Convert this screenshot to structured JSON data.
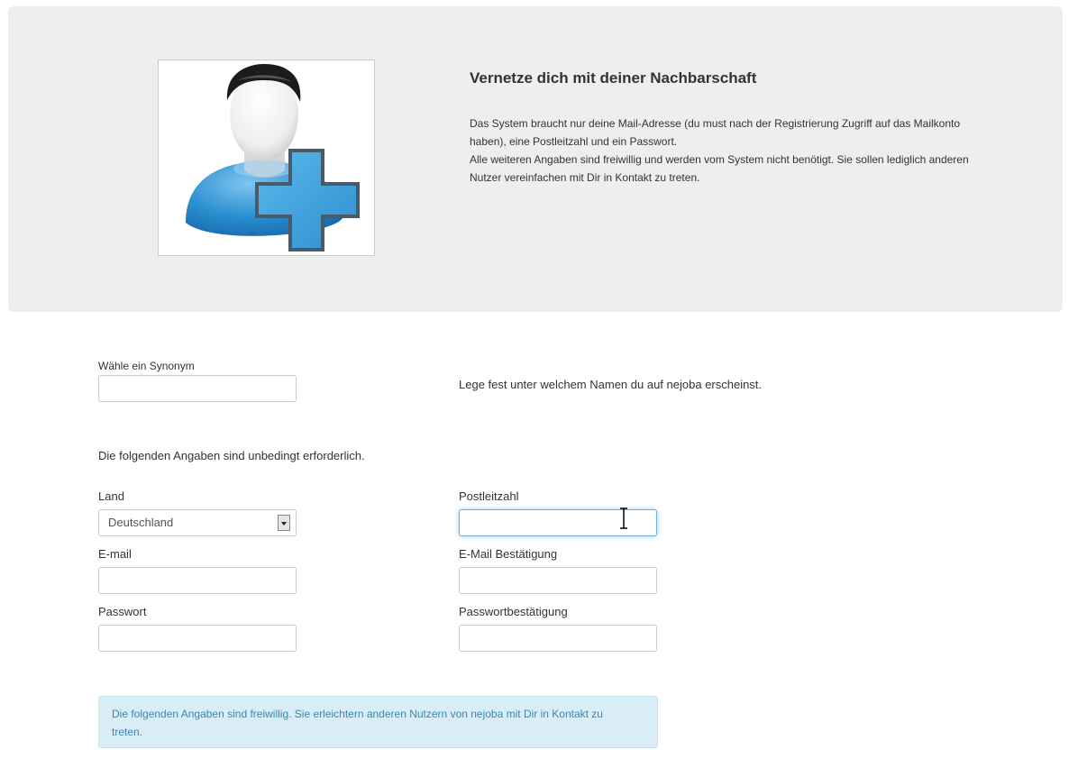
{
  "hero": {
    "title": "Vernetze dich mit deiner Nachbarschaft",
    "paragraph1": "Das System braucht nur deine Mail-Adresse (du must nach der Registrierung Zugriff auf das Mailkonto haben), eine Postleitzahl und ein Passwort.",
    "paragraph2": "Alle weiteren Angaben sind freiwillig und werden vom System nicht benötigt. Sie sollen lediglich anderen Nutzer vereinfachen mit Dir in Kontakt zu treten.",
    "image_icon": "user-add-icon"
  },
  "synonym": {
    "label": "Wähle ein Synonym",
    "value": "",
    "hint": "Lege fest unter welchem Namen du auf nejoba erscheinst."
  },
  "required_note": "Die folgenden Angaben sind unbedingt erforderlich.",
  "form": {
    "country_label": "Land",
    "country_value": "Deutschland",
    "zip_label": "Postleitzahl",
    "zip_value": "",
    "email_label": "E-mail",
    "email_value": "",
    "email_confirm_label": "E-Mail Bestätigung",
    "email_confirm_value": "",
    "password_label": "Passwort",
    "password_value": "",
    "password_confirm_label": "Passwortbestätigung",
    "password_confirm_value": ""
  },
  "optional_note": "Die folgenden Angaben sind freiwillig. Sie erleichtern anderen Nutzern von nejoba mit Dir in Kontakt zu treten.",
  "colors": {
    "hero_bg": "#eeeeee",
    "info_bg": "#d9edf7",
    "info_text": "#3a87ad",
    "icon_blue": "#2a8fd0",
    "focus_border": "#66afe9"
  }
}
